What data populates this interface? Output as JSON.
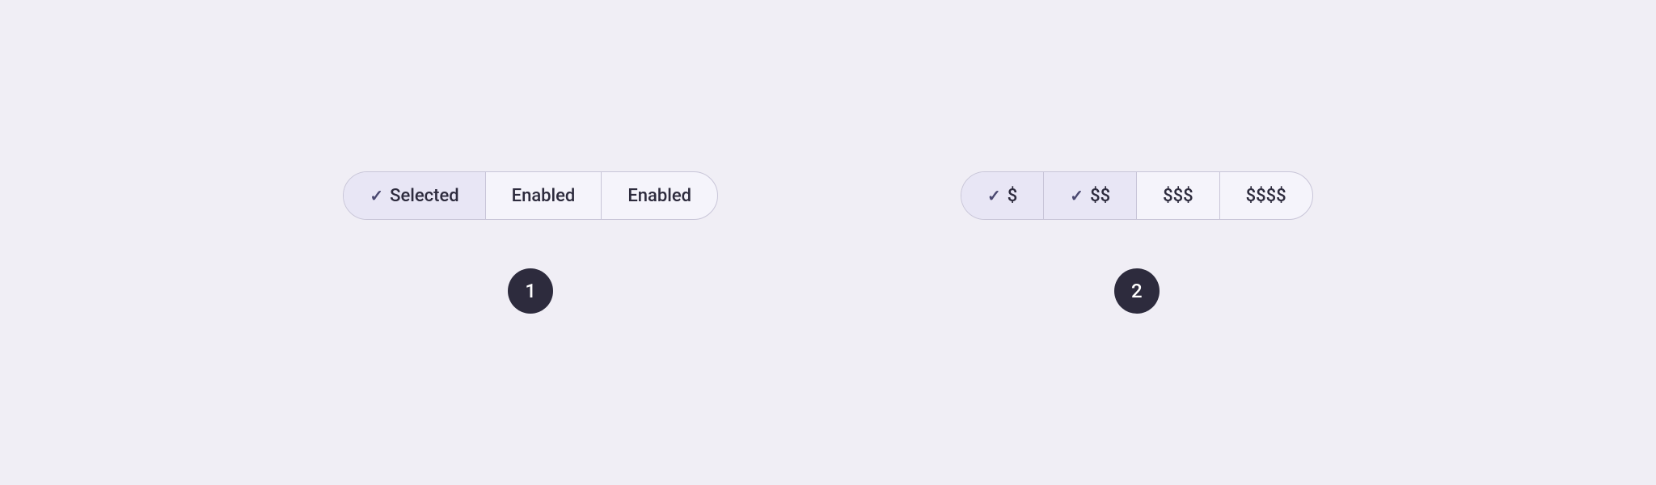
{
  "demo1": {
    "badge": "1",
    "segments": [
      {
        "id": "seg1-selected",
        "label": "Selected",
        "selected": true,
        "showCheck": true
      },
      {
        "id": "seg1-enabled1",
        "label": "Enabled",
        "selected": false,
        "showCheck": false
      },
      {
        "id": "seg1-enabled2",
        "label": "Enabled",
        "selected": false,
        "showCheck": false
      }
    ]
  },
  "demo2": {
    "badge": "2",
    "segments": [
      {
        "id": "seg2-dollar1",
        "label": "$",
        "selected": true,
        "showCheck": true
      },
      {
        "id": "seg2-dollar2",
        "label": "$$",
        "selected": true,
        "showCheck": true
      },
      {
        "id": "seg2-dollar3",
        "label": "$$$",
        "selected": false,
        "showCheck": false
      },
      {
        "id": "seg2-dollar4",
        "label": "$$$$",
        "selected": false,
        "showCheck": false
      }
    ]
  }
}
